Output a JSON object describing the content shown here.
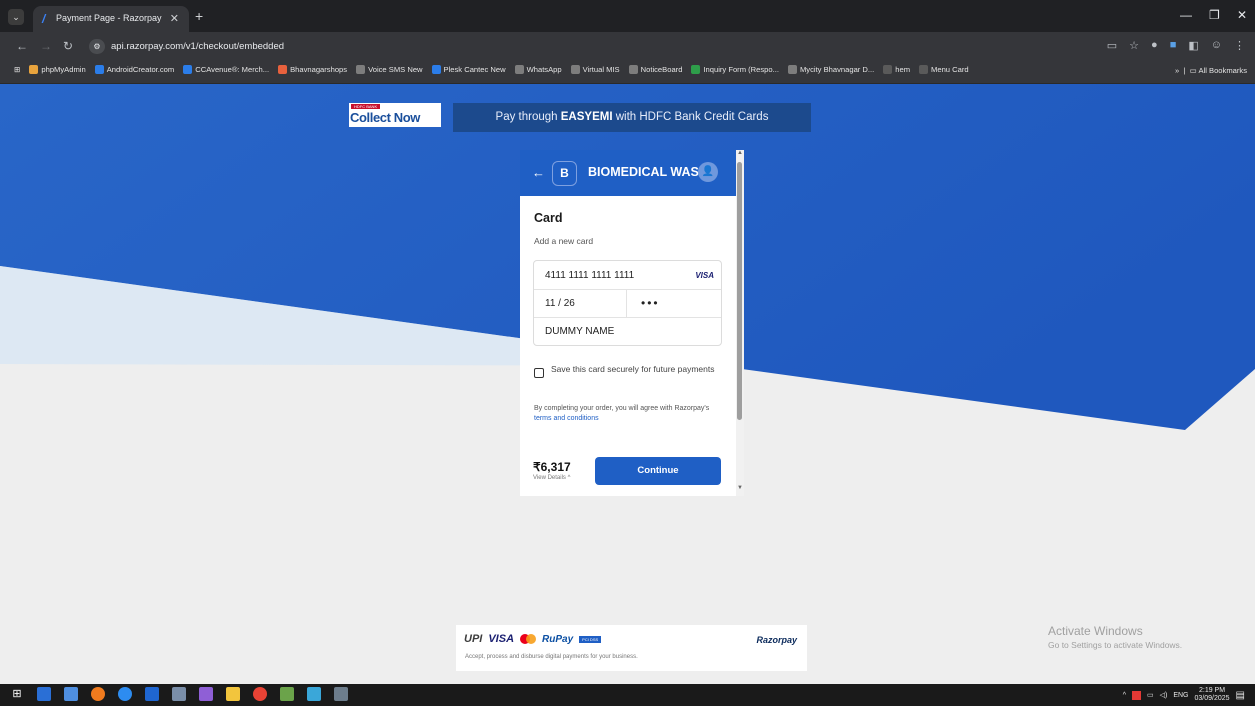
{
  "browser": {
    "tab_title": "Payment Page - Razorpay",
    "url": "api.razorpay.com/v1/checkout/embedded",
    "bookmarks": [
      {
        "label": "phpMyAdmin",
        "icon": "php-icon",
        "color": "#e8a33d"
      },
      {
        "label": "AndroidCreator.com",
        "icon": "android-creator-icon",
        "color": "#2b7de9"
      },
      {
        "label": "CCAvenue®: Merch...",
        "icon": "ccavenue-icon",
        "color": "#2b7de9"
      },
      {
        "label": "Bhavnagarshops",
        "icon": "bhavnagarshops-icon",
        "color": "#e8613d"
      },
      {
        "label": "Voice SMS New",
        "icon": "globe-icon",
        "color": "#7d7d7d"
      },
      {
        "label": "Plesk Cantec New",
        "icon": "plesk-icon",
        "color": "#2b7de9"
      },
      {
        "label": "WhatsApp",
        "icon": "globe-icon",
        "color": "#7d7d7d"
      },
      {
        "label": "Virtual MIS",
        "icon": "globe-icon",
        "color": "#7d7d7d"
      },
      {
        "label": "NoticeBoard",
        "icon": "globe-icon",
        "color": "#7d7d7d"
      },
      {
        "label": "Inquiry Form (Respo...",
        "icon": "forms-icon",
        "color": "#2e9e4a"
      },
      {
        "label": "Mycity Bhavnagar D...",
        "icon": "globe-icon",
        "color": "#7d7d7d"
      },
      {
        "label": "hem",
        "icon": "hem-icon",
        "color": "#5a5a5a"
      },
      {
        "label": "Menu Card",
        "icon": "menu-card-icon",
        "color": "#5a5a5a"
      }
    ],
    "all_bookmarks": "All Bookmarks"
  },
  "promo": {
    "logo_bank": "HDFC BANK",
    "logo_text": "Collect Now",
    "banner_pre": "Pay through ",
    "banner_bold": "EASYEMI",
    "banner_post": " with HDFC Bank Credit Cards"
  },
  "checkout": {
    "merchant_initial": "B",
    "merchant_name": "BIOMEDICAL WAS...",
    "section_title": "Card",
    "subtitle": "Add a new card",
    "card_number": "4111 1111 1111 1111",
    "card_brand": "VISA",
    "expiry": "11 / 26",
    "cvv_mask": "•••",
    "name_on_card": "DUMMY NAME",
    "save_card_label": "Save this card securely for future payments",
    "terms_pre": "By completing your order, you will agree with Razorpay's ",
    "terms_link": "terms and conditions",
    "amount": "₹6,317",
    "view_details": "View Details ^",
    "continue_label": "Continue",
    "accent_color": "#1f5fc5"
  },
  "footer": {
    "upi": "UPI",
    "visa": "VISA",
    "rupay": "RuPay",
    "pci": "PCI DSS",
    "brand": "Razorpay",
    "tagline": "Accept, process and disburse digital payments for your business."
  },
  "windows": {
    "activate_title": "Activate Windows",
    "activate_sub": "Go to Settings to activate Windows.",
    "lang": "ENG",
    "time": "2:19 PM",
    "date": "03/09/2025"
  }
}
